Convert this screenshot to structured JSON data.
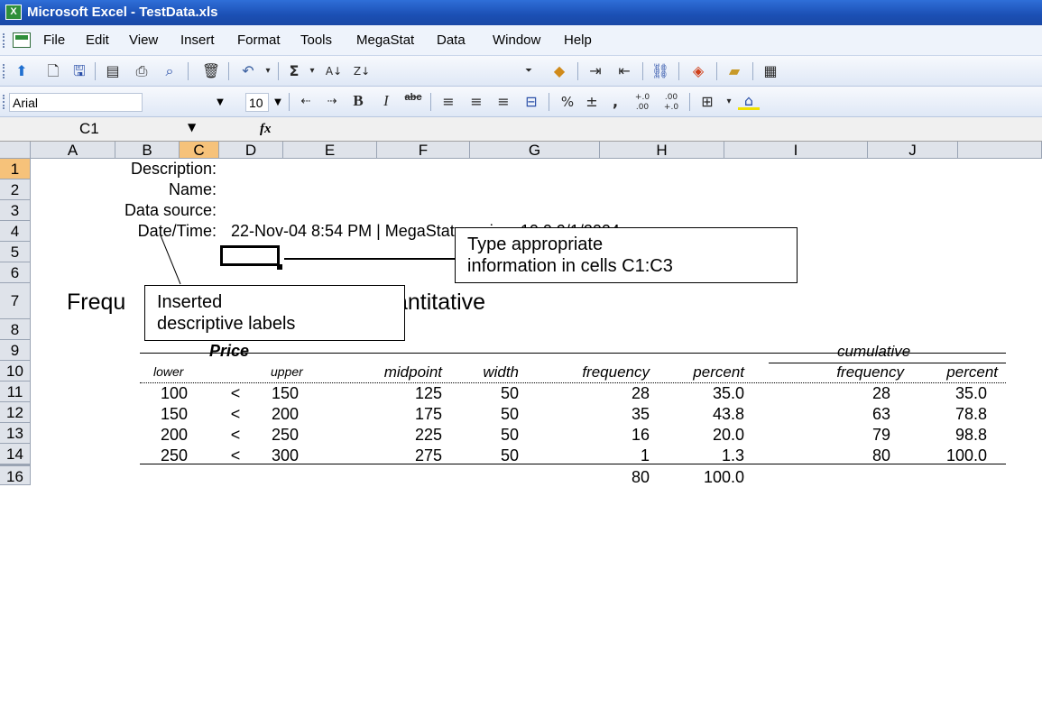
{
  "window": {
    "title": "Microsoft Excel - TestData.xls"
  },
  "menu": [
    "File",
    "Edit",
    "View",
    "Insert",
    "Format",
    "Tools",
    "MegaStat",
    "Data",
    "Window",
    "Help"
  ],
  "toolbar": {
    "font_name": "Arial",
    "font_size": "10",
    "bold_label": "B",
    "italic_label": "I",
    "strike_label": "abc",
    "percent_label": "%",
    "comma_label": ",",
    "inc_decimal_label": "+.0 .00",
    "dec_decimal_label": ".00 +.0",
    "sum_label": "Σ",
    "fx_label": "fx"
  },
  "formula_bar": {
    "name_box": "C1",
    "formula": ""
  },
  "columns": [
    "A",
    "B",
    "C",
    "D",
    "E",
    "F",
    "G",
    "H",
    "I",
    "J"
  ],
  "rows": [
    "1",
    "2",
    "3",
    "4",
    "5",
    "6",
    "7",
    "8",
    "9",
    "10",
    "11",
    "12",
    "13",
    "14",
    "16"
  ],
  "sheet": {
    "labels": {
      "description": "Description:",
      "name": "Name:",
      "data_source": "Data source:",
      "date_time": "Date/Time:",
      "date_time_value": "22-Nov-04 8:54 PM | MegaStat version: 10.0 9/1/2004",
      "title_left": "Frequ",
      "title_right": "antitative"
    },
    "table": {
      "variable": "Price",
      "cumulative": "cumulative",
      "headers": [
        "lower",
        "upper",
        "midpoint",
        "width",
        "frequency",
        "percent",
        "frequency",
        "percent"
      ],
      "rows": [
        {
          "lower": "100",
          "sym": "<",
          "upper": "150",
          "midpoint": "125",
          "width": "50",
          "frequency": "28",
          "percent": "35.0",
          "cum_frequency": "28",
          "cum_percent": "35.0"
        },
        {
          "lower": "150",
          "sym": "<",
          "upper": "200",
          "midpoint": "175",
          "width": "50",
          "frequency": "35",
          "percent": "43.8",
          "cum_frequency": "63",
          "cum_percent": "78.8"
        },
        {
          "lower": "200",
          "sym": "<",
          "upper": "250",
          "midpoint": "225",
          "width": "50",
          "frequency": "16",
          "percent": "20.0",
          "cum_frequency": "79",
          "cum_percent": "98.8"
        },
        {
          "lower": "250",
          "sym": "<",
          "upper": "300",
          "midpoint": "275",
          "width": "50",
          "frequency": "1",
          "percent": "1.3",
          "cum_frequency": "80",
          "cum_percent": "100.0"
        }
      ],
      "totals": {
        "frequency": "80",
        "percent": "100.0"
      }
    }
  },
  "callouts": {
    "type_info": [
      "Type appropriate",
      "information in cells C1:C3"
    ],
    "inserted": [
      "Inserted",
      "descriptive labels"
    ]
  },
  "colors": {
    "title_bar": "#1b4fb4",
    "selected_header": "#f6c27a",
    "header_bg": "#dfe3ea"
  }
}
